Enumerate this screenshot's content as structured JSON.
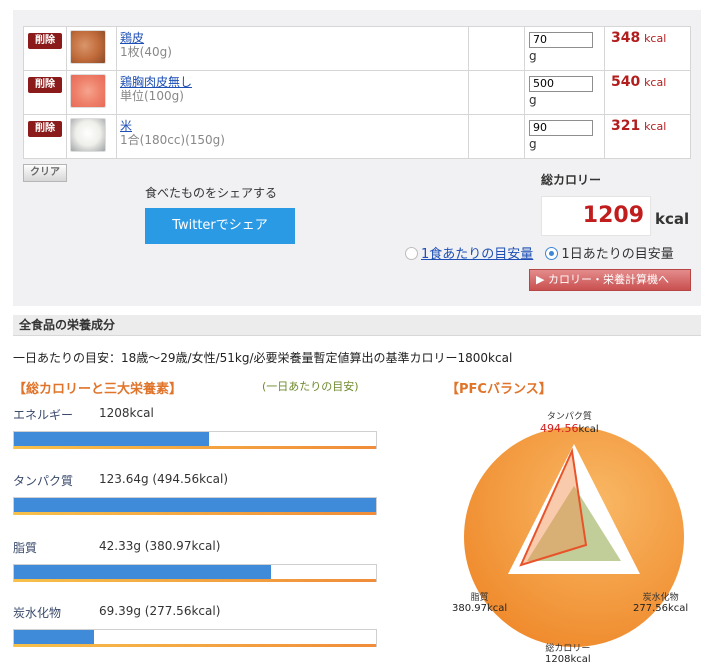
{
  "foods": [
    {
      "delete_label": "削除",
      "name": "鶏皮",
      "unit": "1枚(40g)",
      "qty": "70",
      "qty_unit": "g",
      "kcal": "348",
      "kcal_unit": "kcal",
      "thumb_icon": "chicken-skin-photo"
    },
    {
      "delete_label": "削除",
      "name": "鶏胸肉皮無し",
      "unit": "単位(100g)",
      "qty": "500",
      "qty_unit": "g",
      "kcal": "540",
      "kcal_unit": "kcal",
      "thumb_icon": "chicken-breast-photo"
    },
    {
      "delete_label": "削除",
      "name": "米",
      "unit": "1合(180cc)(150g)",
      "qty": "90",
      "qty_unit": "g",
      "kcal": "321",
      "kcal_unit": "kcal",
      "thumb_icon": "rice-photo"
    }
  ],
  "clear_label": "クリア",
  "share": {
    "text": "食べたものをシェアする",
    "button": "Twitterでシェア"
  },
  "total": {
    "label": "総カロリー",
    "value": "1209",
    "unit": "kcal"
  },
  "radio": {
    "per_meal": "1食あたりの目安量",
    "per_day": "1日あたりの目安量",
    "selected": "per_day"
  },
  "calc_button": "▶ カロリー・栄養計算機へ",
  "section_title": "全食品の栄養成分",
  "guide": "一日あたりの目安：18歳〜29歳/女性/51kg/必要栄養量暫定値算出の基準カロリー1800kcal",
  "left_title": "【総カロリーと三大栄養素】",
  "left_sub": "(一日あたりの目安)",
  "right_title": "【PFCバランス】",
  "nutrients": [
    {
      "label": "エネルギー",
      "value": "1208kcal",
      "fill_ratio": 0.54
    },
    {
      "label": "タンパク質",
      "value": "123.64g (494.56kcal)",
      "fill_ratio": 1.0
    },
    {
      "label": "脂質",
      "value": "42.33g (380.97kcal)",
      "fill_ratio": 0.71
    },
    {
      "label": "炭水化物",
      "value": "69.39g (277.56kcal)",
      "fill_ratio": 0.22
    }
  ],
  "pfc": {
    "protein": {
      "name": "タンパク質",
      "value": "494.56",
      "unit": "kcal",
      "ratio": 0.9
    },
    "fat": {
      "name": "脂質",
      "value": "380.97kcal"
    },
    "carb": {
      "name": "炭水化物",
      "value": "277.56kcal"
    },
    "total": {
      "name": "総カロリー",
      "value": "1208kcal"
    },
    "colors": {
      "circle": "#f5a04a",
      "target": "#b7c587",
      "actual": "#f58a4a",
      "actual_line": "#e8542a"
    }
  }
}
